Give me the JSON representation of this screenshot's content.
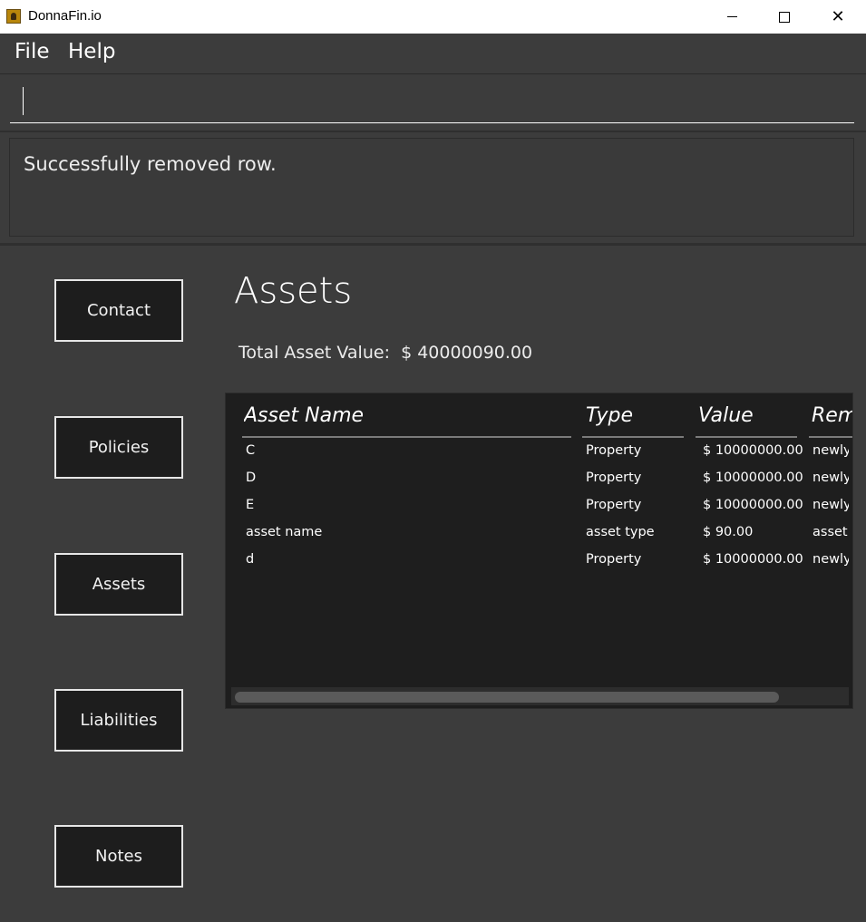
{
  "window": {
    "title": "DonnaFin.io",
    "minimize_glyph": "",
    "maximize_glyph": "",
    "close_glyph": "✕"
  },
  "menu": {
    "file": "File",
    "help": "Help"
  },
  "command": {
    "value": ""
  },
  "result": {
    "message": "Successfully removed row."
  },
  "sidebar": {
    "items": [
      {
        "label": "Contact"
      },
      {
        "label": "Policies"
      },
      {
        "label": "Assets"
      },
      {
        "label": "Liabilities"
      },
      {
        "label": "Notes"
      }
    ]
  },
  "main": {
    "title": "Assets",
    "total_label": "Total Asset Value:",
    "total_value": "$ 40000090.00"
  },
  "table": {
    "columns": [
      "Asset Name",
      "Type",
      "Value",
      "Rem"
    ],
    "rows": [
      {
        "name": "C",
        "type": "Property",
        "value": "$ 10000000.00",
        "remarks": "newly"
      },
      {
        "name": "D",
        "type": "Property",
        "value": "$ 10000000.00",
        "remarks": "newly"
      },
      {
        "name": "E",
        "type": "Property",
        "value": "$ 10000000.00",
        "remarks": "newly"
      },
      {
        "name": "asset name",
        "type": "asset type",
        "value": "$ 90.00",
        "remarks": "asset r"
      },
      {
        "name": "d",
        "type": "Property",
        "value": "$ 10000000.00",
        "remarks": "newly"
      }
    ]
  }
}
